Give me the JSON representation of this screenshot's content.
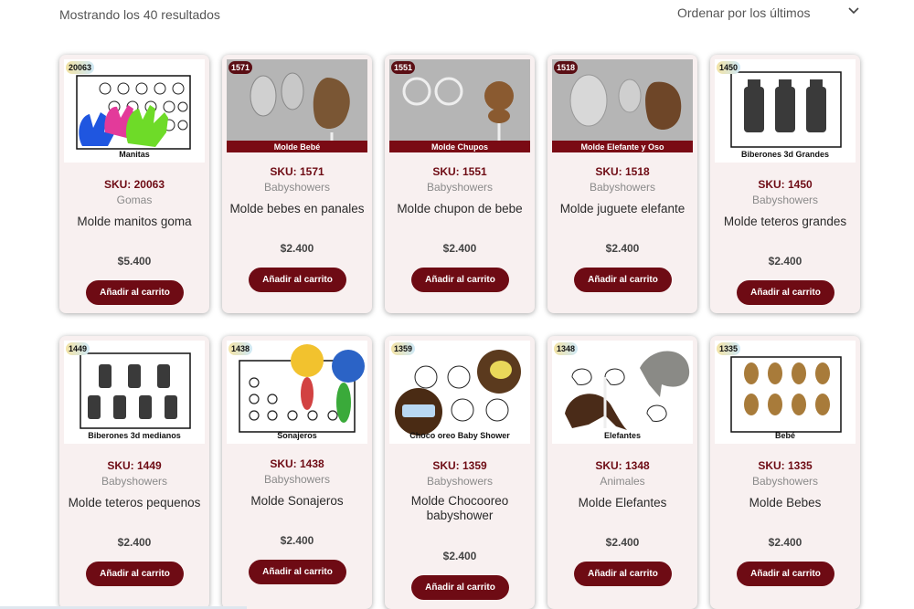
{
  "header": {
    "results": "Mostrando los 40 resultados",
    "sort_label": "Ordenar por los últimos"
  },
  "colors": {
    "accent": "#6e0b14",
    "card_bg": "#f8f0f0",
    "price": "#444444"
  },
  "products": [
    {
      "badge": "20063",
      "caption": "Manitas",
      "sku": "SKU: 20063",
      "category": "Gomas",
      "name": "Molde manitos goma",
      "price": "$5.400",
      "button": "Añadir al carrito"
    },
    {
      "badge": "1571",
      "caption": "Molde Bebé",
      "sku": "SKU: 1571",
      "category": "Babyshowers",
      "name": "Molde bebes en panales",
      "price": "$2.400",
      "button": "Añadir al carrito"
    },
    {
      "badge": "1551",
      "caption": "Molde Chupos",
      "sku": "SKU: 1551",
      "category": "Babyshowers",
      "name": "Molde chupon de bebe",
      "price": "$2.400",
      "button": "Añadir al carrito"
    },
    {
      "badge": "1518",
      "caption": "Molde Elefante y Oso",
      "sku": "SKU: 1518",
      "category": "Babyshowers",
      "name": "Molde juguete elefante",
      "price": "$2.400",
      "button": "Añadir al carrito"
    },
    {
      "badge": "1450",
      "caption": "Biberones 3d Grandes",
      "sku": "SKU: 1450",
      "category": "Babyshowers",
      "name": "Molde teteros grandes",
      "price": "$2.400",
      "button": "Añadir al carrito"
    },
    {
      "badge": "1449",
      "caption": "Biberones 3d medianos",
      "sku": "SKU: 1449",
      "category": "Babyshowers",
      "name": "Molde teteros pequenos",
      "price": "$2.400",
      "button": "Añadir al carrito"
    },
    {
      "badge": "1438",
      "caption": "Sonajeros",
      "sku": "SKU: 1438",
      "category": "Babyshowers",
      "name": "Molde Sonajeros",
      "price": "$2.400",
      "button": "Añadir al carrito"
    },
    {
      "badge": "1359",
      "caption": "Choco oreo Baby Shower",
      "sku": "SKU: 1359",
      "category": "Babyshowers",
      "name": "Molde Chocooreo babyshower",
      "price": "$2.400",
      "button": "Añadir al carrito"
    },
    {
      "badge": "1348",
      "caption": "Elefantes",
      "sku": "SKU: 1348",
      "category": "Animales",
      "name": "Molde Elefantes",
      "price": "$2.400",
      "button": "Añadir al carrito"
    },
    {
      "badge": "1335",
      "caption": "Bebé",
      "sku": "SKU: 1335",
      "category": "Babyshowers",
      "name": "Molde Bebes",
      "price": "$2.400",
      "button": "Añadir al carrito"
    }
  ]
}
